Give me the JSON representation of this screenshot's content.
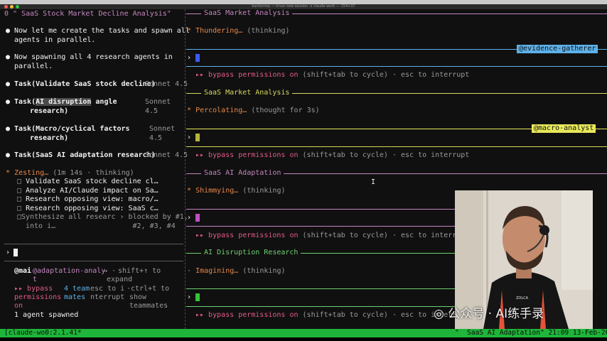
{
  "window": {
    "title": "bartlomiej — tmux new-session -s claude-work — 154×37"
  },
  "left_pane": {
    "header": "0 \" SaaS Stock Market Decline Analysis\"",
    "messages": [
      {
        "line1": "Now let me create the tasks and spawn all",
        "line2": "agents in parallel."
      },
      {
        "line1": "Now spawning all 4 research agents in",
        "line2": "parallel."
      }
    ],
    "tasks": [
      {
        "name": "Task(Validate SaaS stock decline)",
        "model": "Sonnet 4.5"
      },
      {
        "name_prefix": "Task(",
        "name_sel": "AI disruption",
        "name_rest": " angle",
        "name_line2": "research)",
        "model": "Sonnet",
        "model2": "4.5"
      },
      {
        "name": "Task(Macro/cyclical factors",
        "name_line2": "research)",
        "model": "Sonnet",
        "model2": "4.5"
      },
      {
        "name": "Task(SaaS AI adaptation research)",
        "model": "Sonnet 4.5"
      }
    ],
    "spinner": {
      "symbol": "*",
      "word": "Zesting…",
      "detail": "(1m 14s · thinking)"
    },
    "todos": [
      {
        "box": "□",
        "text": "Validate SaaS stock decline cl…"
      },
      {
        "box": "□",
        "text": "Analyze AI/Claude impact on Sa…"
      },
      {
        "box": "□",
        "text": "Research opposing view: macro/…"
      },
      {
        "box": "□",
        "text": "Research opposing view: SaaS c…"
      },
      {
        "box": "□",
        "text": "Synthesize all researc › blocked by #1,",
        "line2": "into i…                  #2, #3, #4"
      }
    ],
    "prompt": "›",
    "footer": {
      "user": "@mai",
      "agent_line1": "@adaptation-analy",
      "agent_line2": "t",
      "arrow": "→ ·",
      "shift_line1": "shift+↑ to",
      "shift_line2": "expand",
      "bypass_l1": "▸▸ bypass",
      "bypass_l2": "permissions",
      "bypass_l3": "on",
      "team_l1": "4 team",
      "team_l2": "mates",
      "esc_l1": "esc to i",
      "esc_l2": "nterrupt",
      "ctrl_l1": "·ctrl+t to",
      "ctrl_l2": "show",
      "ctrl_l3": "teammates",
      "spawned": "1 agent spawned"
    }
  },
  "right_panes": [
    {
      "title": "SaaS Market Analysis",
      "color": "#c586c0",
      "status_symbol": "*",
      "status_word": "Thundering…",
      "status_detail": "(thinking)",
      "prompt": "›",
      "cursor_color": "#3a5bff",
      "agent_tag": "@evidence-gatherer",
      "tag_color": "#5db0e8",
      "bypass": "▸▸ bypass permissions on",
      "bypass_hint": "(shift+tab to cycle) · esc to interrupt"
    },
    {
      "title": "SaaS Market Analysis",
      "color": "#d7d75f",
      "status_symbol": "*",
      "status_word": "Percolating…",
      "status_detail": "(thought for 3s)",
      "prompt": "›",
      "cursor_color": "#b6b63a",
      "agent_tag": "@macro-analyst",
      "tag_color": "#e8e85a",
      "bypass": "▸▸ bypass permissions on",
      "bypass_hint": "(shift+tab to cycle) · esc to interrupt"
    },
    {
      "title": "SaaS AI Adaptation",
      "color": "#c586c0",
      "status_symbol": "*",
      "status_word": "Shimmying…",
      "status_detail": "(thinking)",
      "prompt": "›",
      "cursor_color": "#c04ec0",
      "bypass": "▸▸ bypass permissions on",
      "bypass_hint": "(shift+tab to cycle) · esc to interrupt"
    },
    {
      "title": "AI Disruption Research",
      "color": "#6fcf6f",
      "status_symbol": "·",
      "status_word": "Imagining…",
      "status_detail": "(thinking)",
      "prompt": "›",
      "cursor_color": "#35c335",
      "bypass": "▸▸ bypass permissions on",
      "bypass_hint": "(shift+tab to cycle) · esc to interrupt"
    }
  ],
  "status_bar": {
    "left": "[claude-wo0:2.1.41*",
    "right": "\"  SaaS AI Adaptation\" 21:09 13-Feb-26"
  },
  "watermark": "公众号 · AI练手录",
  "webcam": {
    "shirt_text": "ZOLCA"
  },
  "text_cursor": "I"
}
